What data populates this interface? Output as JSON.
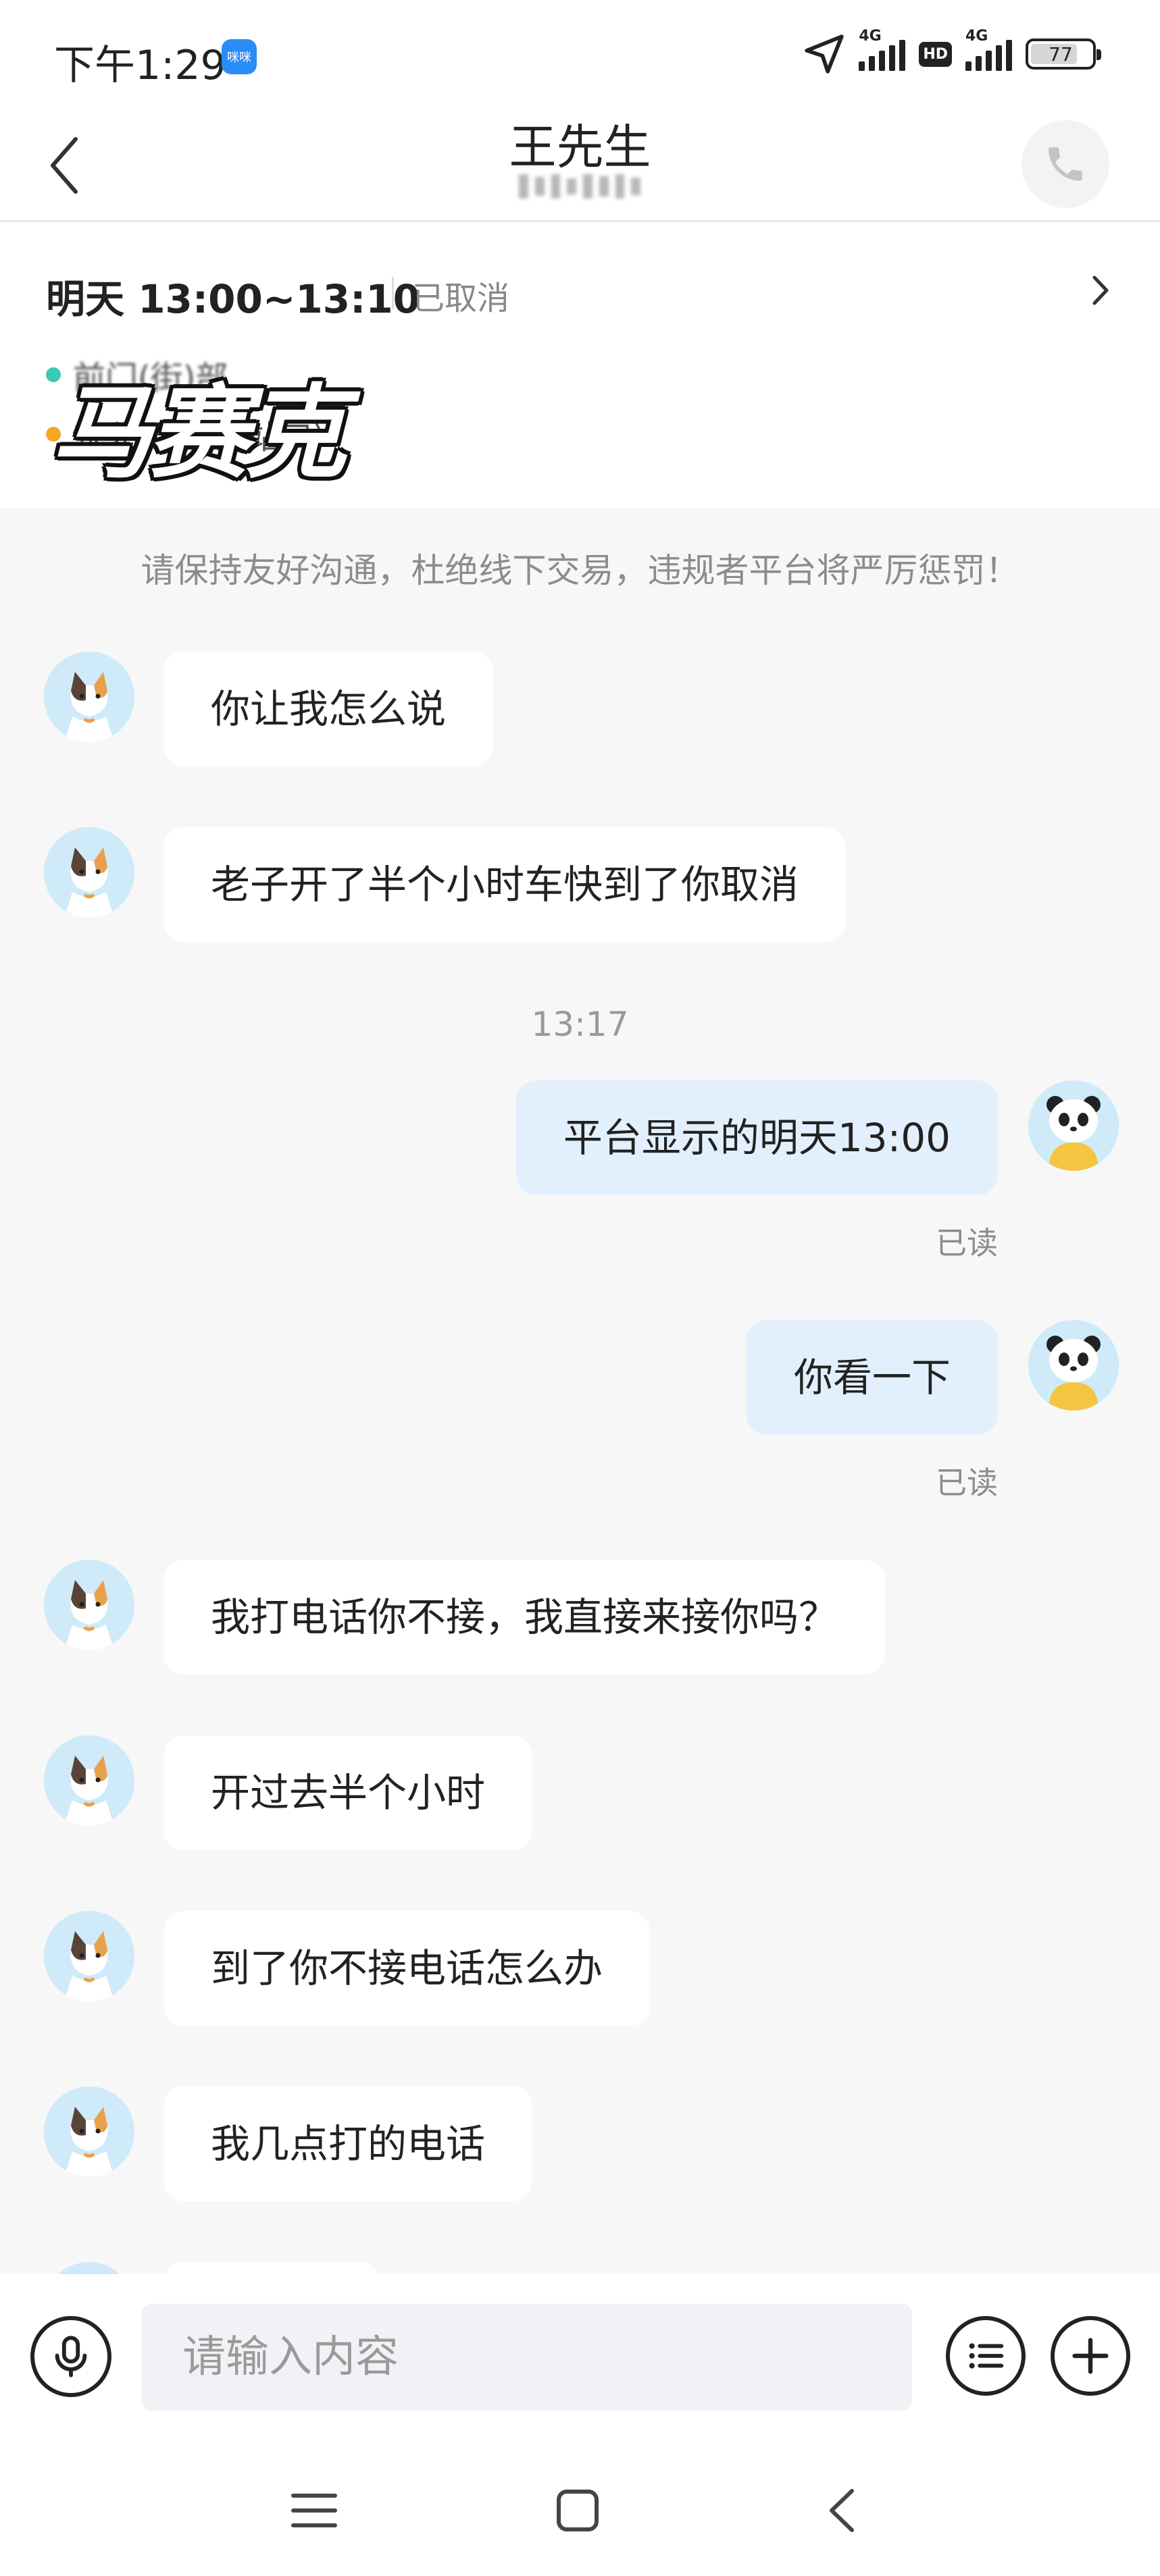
{
  "status_bar": {
    "time": "下午1:29",
    "app_badge": "咪咪",
    "network_1": "4G",
    "hd_label": "HD",
    "network_2": "4G",
    "battery": "77",
    "battery_level": 0.77
  },
  "header": {
    "title": "王先生"
  },
  "appointment": {
    "time": "明天 13:00~13:10",
    "status": "已取消",
    "line1": "前门(街)部",
    "line2": "东北门站(进站口)",
    "watermark": "马赛克",
    "dot_colors": [
      "#3cc8b4",
      "#f5a623"
    ]
  },
  "chat": {
    "notice": "请保持友好沟通，杜绝线下交易，违规者平台将严厉惩罚！",
    "timestamp": "13:17",
    "messages": [
      {
        "side": "in",
        "text": "你让我怎么说"
      },
      {
        "side": "in",
        "text": "老子开了半个小时车快到了你取消"
      },
      {
        "side": "out",
        "text": "平台显示的明天13:00",
        "status": "已读"
      },
      {
        "side": "out",
        "text": "你看一下",
        "status": "已读"
      },
      {
        "side": "in",
        "text": "我打电话你不接，我直接来接你吗？"
      },
      {
        "side": "in",
        "text": "开过去半个小时"
      },
      {
        "side": "in",
        "text": "到了你不接电话怎么办"
      },
      {
        "side": "in",
        "text": "我几点打的电话"
      }
    ]
  },
  "input": {
    "placeholder": "请输入内容"
  },
  "colors": {
    "accent_blue": "#2a8cf7",
    "outgoing_bubble": "#e2f0fd",
    "incoming_bubble": "#ffffff",
    "background": "#f7f7f7"
  }
}
